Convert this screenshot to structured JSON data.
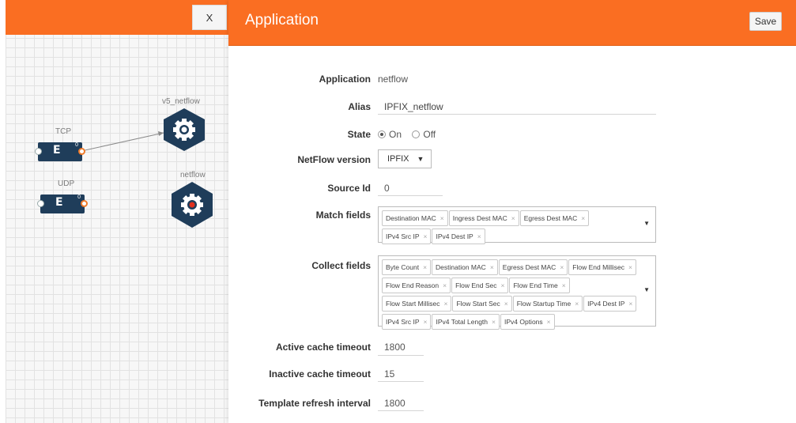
{
  "canvas": {
    "close_label": "X",
    "nodes": {
      "tcp_label": "TCP",
      "udp_label": "UDP",
      "v5_label": "v5_netflow",
      "netflow_label": "netflow",
      "gs_glyph": "E",
      "port_num": "0"
    }
  },
  "panel": {
    "title": "Application",
    "save_label": "Save",
    "fields": {
      "application": {
        "label": "Application",
        "value": "netflow"
      },
      "alias": {
        "label": "Alias",
        "value": "IPFIX_netflow"
      },
      "state": {
        "label": "State",
        "on": "On",
        "off": "Off",
        "selected": "On"
      },
      "netflow_version": {
        "label": "NetFlow version",
        "value": "IPFIX"
      },
      "source_id": {
        "label": "Source Id",
        "value": "0"
      },
      "match_fields": {
        "label": "Match fields",
        "tags": [
          "Destination MAC",
          "Ingress Dest MAC",
          "Egress Dest MAC",
          "IPv4 Src IP",
          "IPv4 Dest IP"
        ]
      },
      "collect_fields": {
        "label": "Collect fields",
        "tags": [
          "Byte Count",
          "Destination MAC",
          "Egress Dest MAC",
          "Flow End Millisec",
          "Flow End Reason",
          "Flow End Sec",
          "Flow End Time",
          "Flow Start Millisec",
          "Flow Start Sec",
          "Flow Startup Time",
          "IPv4 Dest IP",
          "IPv4 Src IP",
          "IPv4 Total Length",
          "IPv4 Options"
        ]
      },
      "active_cache_timeout": {
        "label": "Active cache timeout",
        "value": "1800"
      },
      "inactive_cache_timeout": {
        "label": "Inactive cache timeout",
        "value": "15"
      },
      "template_refresh_interval": {
        "label": "Template refresh interval",
        "value": "1800"
      }
    }
  },
  "colors": {
    "accent": "#fa6e22",
    "node": "#1f3d5a",
    "hex": "#1f3d5a",
    "selected_dot": "#e0301e"
  },
  "icons": [
    "gear-icon",
    "close-icon",
    "chevron-down-icon"
  ]
}
